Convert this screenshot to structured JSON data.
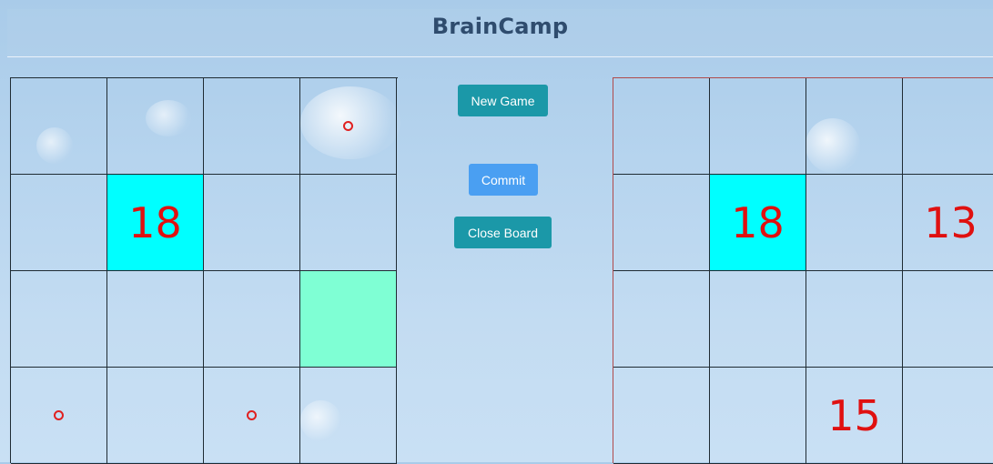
{
  "header": {
    "title": "BrainCamp"
  },
  "controls": {
    "new_game": "New Game",
    "commit": "Commit",
    "close_board": "Close Board"
  },
  "colors": {
    "highlight_cyan": "#00ffff",
    "highlight_mint": "#7fffd4",
    "number_red": "#e01010",
    "teal_button": "#1b98a8",
    "blue_button": "#4a9ff2"
  },
  "left_board": {
    "rows": [
      [
        {
          "v": ""
        },
        {
          "v": ""
        },
        {
          "v": ""
        },
        {
          "v": "",
          "mark": "circle"
        }
      ],
      [
        {
          "v": ""
        },
        {
          "v": "18",
          "fill": "cyan"
        },
        {
          "v": ""
        },
        {
          "v": ""
        }
      ],
      [
        {
          "v": ""
        },
        {
          "v": ""
        },
        {
          "v": ""
        },
        {
          "v": "",
          "fill": "mint"
        }
      ],
      [
        {
          "v": "",
          "mark": "circle"
        },
        {
          "v": ""
        },
        {
          "v": "",
          "mark": "circle"
        },
        {
          "v": ""
        }
      ]
    ]
  },
  "right_board": {
    "rows": [
      [
        {
          "v": ""
        },
        {
          "v": ""
        },
        {
          "v": ""
        },
        {
          "v": ""
        }
      ],
      [
        {
          "v": ""
        },
        {
          "v": "18",
          "fill": "cyan"
        },
        {
          "v": ""
        },
        {
          "v": "13"
        }
      ],
      [
        {
          "v": ""
        },
        {
          "v": ""
        },
        {
          "v": ""
        },
        {
          "v": ""
        }
      ],
      [
        {
          "v": ""
        },
        {
          "v": ""
        },
        {
          "v": "15"
        },
        {
          "v": ""
        }
      ]
    ]
  }
}
